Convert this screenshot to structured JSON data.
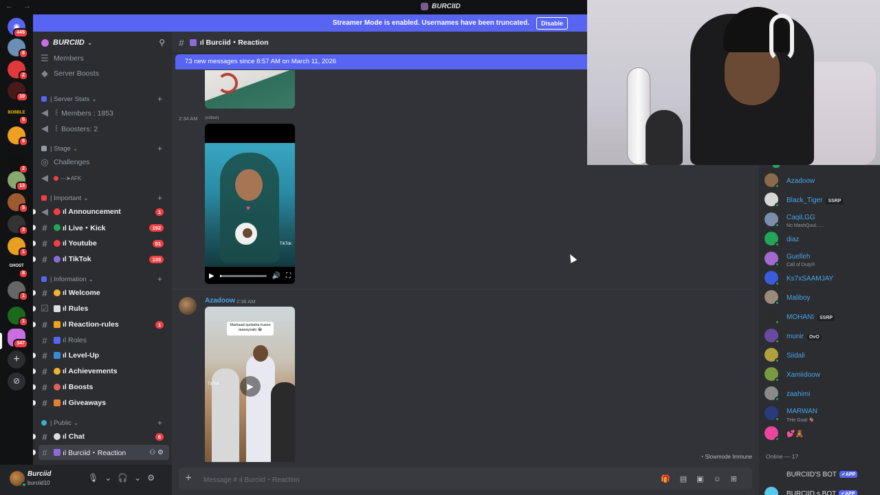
{
  "window": {
    "title": "BURCIID",
    "nav_arrows": "← →"
  },
  "banner": {
    "text": "Streamer Mode is enabled. Usernames have been truncated.",
    "button": "Disable"
  },
  "servers": [
    {
      "badge": "445"
    },
    {
      "badge": "8"
    },
    {
      "badge": "2"
    },
    {
      "badge": "10"
    },
    {
      "badge": "5"
    },
    {
      "badge": "6"
    },
    {
      "badge": "2"
    },
    {
      "badge": "13"
    },
    {
      "badge": "5"
    },
    {
      "badge": "3"
    },
    {
      "badge": "1"
    },
    {
      "badge": "8"
    },
    {
      "badge": "1"
    },
    {
      "badge": "1"
    },
    {
      "badge": "347"
    }
  ],
  "server_labels": {
    "ghost": "GHOST",
    "tag": "BOBBLE"
  },
  "sidebar": {
    "server_name": "BURCIID",
    "members_link": "Members",
    "boosts_link": "Server Boosts",
    "cat_stats": "| Server Stats",
    "stat_members": "꒰ Members : 1853",
    "stat_boosters": "꒰ Boosters: 2",
    "cat_stage": "| Stage",
    "challenges": "Challenges",
    "afk": "---➤AFK",
    "cat_important": "| Important",
    "cat_information": "| Information",
    "cat_public": "| Public",
    "channels": [
      {
        "name": "ıl Announcement",
        "count": "1"
      },
      {
        "name": "ıl Live・Kick",
        "count": "152"
      },
      {
        "name": "ıl Youtube",
        "count": "51"
      },
      {
        "name": "ıl TikTok",
        "count": "133"
      },
      {
        "name": "ıl Welcome",
        "count": ""
      },
      {
        "name": "ıl Rules",
        "count": ""
      },
      {
        "name": "ıl Reaction-rules",
        "count": "1"
      },
      {
        "name": "ıl Roles",
        "count": ""
      },
      {
        "name": "ıl Level-Up",
        "count": ""
      },
      {
        "name": "ıl Achievements",
        "count": ""
      },
      {
        "name": "ıl Boosts",
        "count": ""
      },
      {
        "name": "ıl Giveaways",
        "count": ""
      },
      {
        "name": "ıl Chat",
        "count": "6"
      },
      {
        "name": "ıl Burciid・Reaction",
        "count": ""
      }
    ]
  },
  "user": {
    "name": "Burciid",
    "tag": "burciid10"
  },
  "main": {
    "channel": "ıl Burciid・Reaction",
    "new_messages": "73 new messages since 8:57 AM on March 11, 2026",
    "msg1_time": "2:34 AM",
    "msg1_edited": "(edited)",
    "msg2_author": "Azadoow",
    "msg2_time": "2:36 AM",
    "video2_caption": "Markaad qurbaha kusoo raaxaysato 😂",
    "tiktok": "TikTok",
    "slowmode": "Slowmode Immune",
    "composer_placeholder": "Message # ıl Burciid・Reaction",
    "video_progress": 0.04
  },
  "members": [
    {
      "name": "Azadoow",
      "sub": "",
      "tag": "",
      "color": "#4aa5e8",
      "av": "#8a6a4a"
    },
    {
      "name": "Black_Tiger",
      "sub": "",
      "tag": "SSRP",
      "color": "#4aa5e8",
      "av": "#d7d7d7"
    },
    {
      "name": "CaqiLGG",
      "sub": "No MashQuul......",
      "tag": "",
      "color": "#4aa5e8",
      "av": "#7a8fa8"
    },
    {
      "name": "diaz",
      "sub": "",
      "tag": "",
      "color": "#4aa5e8",
      "av": "#23a55a"
    },
    {
      "name": "Guelleh",
      "sub": "Call of Duty®",
      "tag": "",
      "color": "#4aa5e8",
      "av": "#a06ad0"
    },
    {
      "name": "Ks7xSAAMJAY",
      "sub": "",
      "tag": "",
      "color": "#4aa5e8",
      "av": "#3b5bdb"
    },
    {
      "name": "Maliboy",
      "sub": "",
      "tag": "",
      "color": "#4aa5e8",
      "av": "#9a8a7a"
    },
    {
      "name": "MOHANI",
      "sub": "",
      "tag": "SSRP",
      "color": "#4aa5e8",
      "av": "#2c2c2c"
    },
    {
      "name": "munir",
      "sub": "",
      "tag": "OvO",
      "color": "#4aa5e8",
      "av": "#6a4aa0"
    },
    {
      "name": "Siidali",
      "sub": "",
      "tag": "",
      "color": "#4aa5e8",
      "av": "#b0a040"
    },
    {
      "name": "Xamiidoow",
      "sub": "",
      "tag": "",
      "color": "#4aa5e8",
      "av": "#7a9a40"
    },
    {
      "name": "zaahimi",
      "sub": "",
      "tag": "",
      "color": "#4aa5e8",
      "av": "#8a8a8a"
    },
    {
      "name": "MARWAN",
      "sub": "THe Goat 🐐",
      "tag": "",
      "color": "#4aa5e8",
      "av": "#2a3a7a"
    },
    {
      "name": "💕🧸",
      "sub": "",
      "tag": "",
      "color": "#ff73b3",
      "av": "#eb459f"
    }
  ],
  "online_header": "Online — 17",
  "bots": [
    {
      "name": "BURCIID'S BOT",
      "badge": "✔APP"
    },
    {
      "name": "BURCIID,s BOT",
      "badge": "✔APP"
    }
  ],
  "colors": {
    "blurple": "#5865f2",
    "danger": "#f23f43",
    "online": "#23a55a"
  }
}
